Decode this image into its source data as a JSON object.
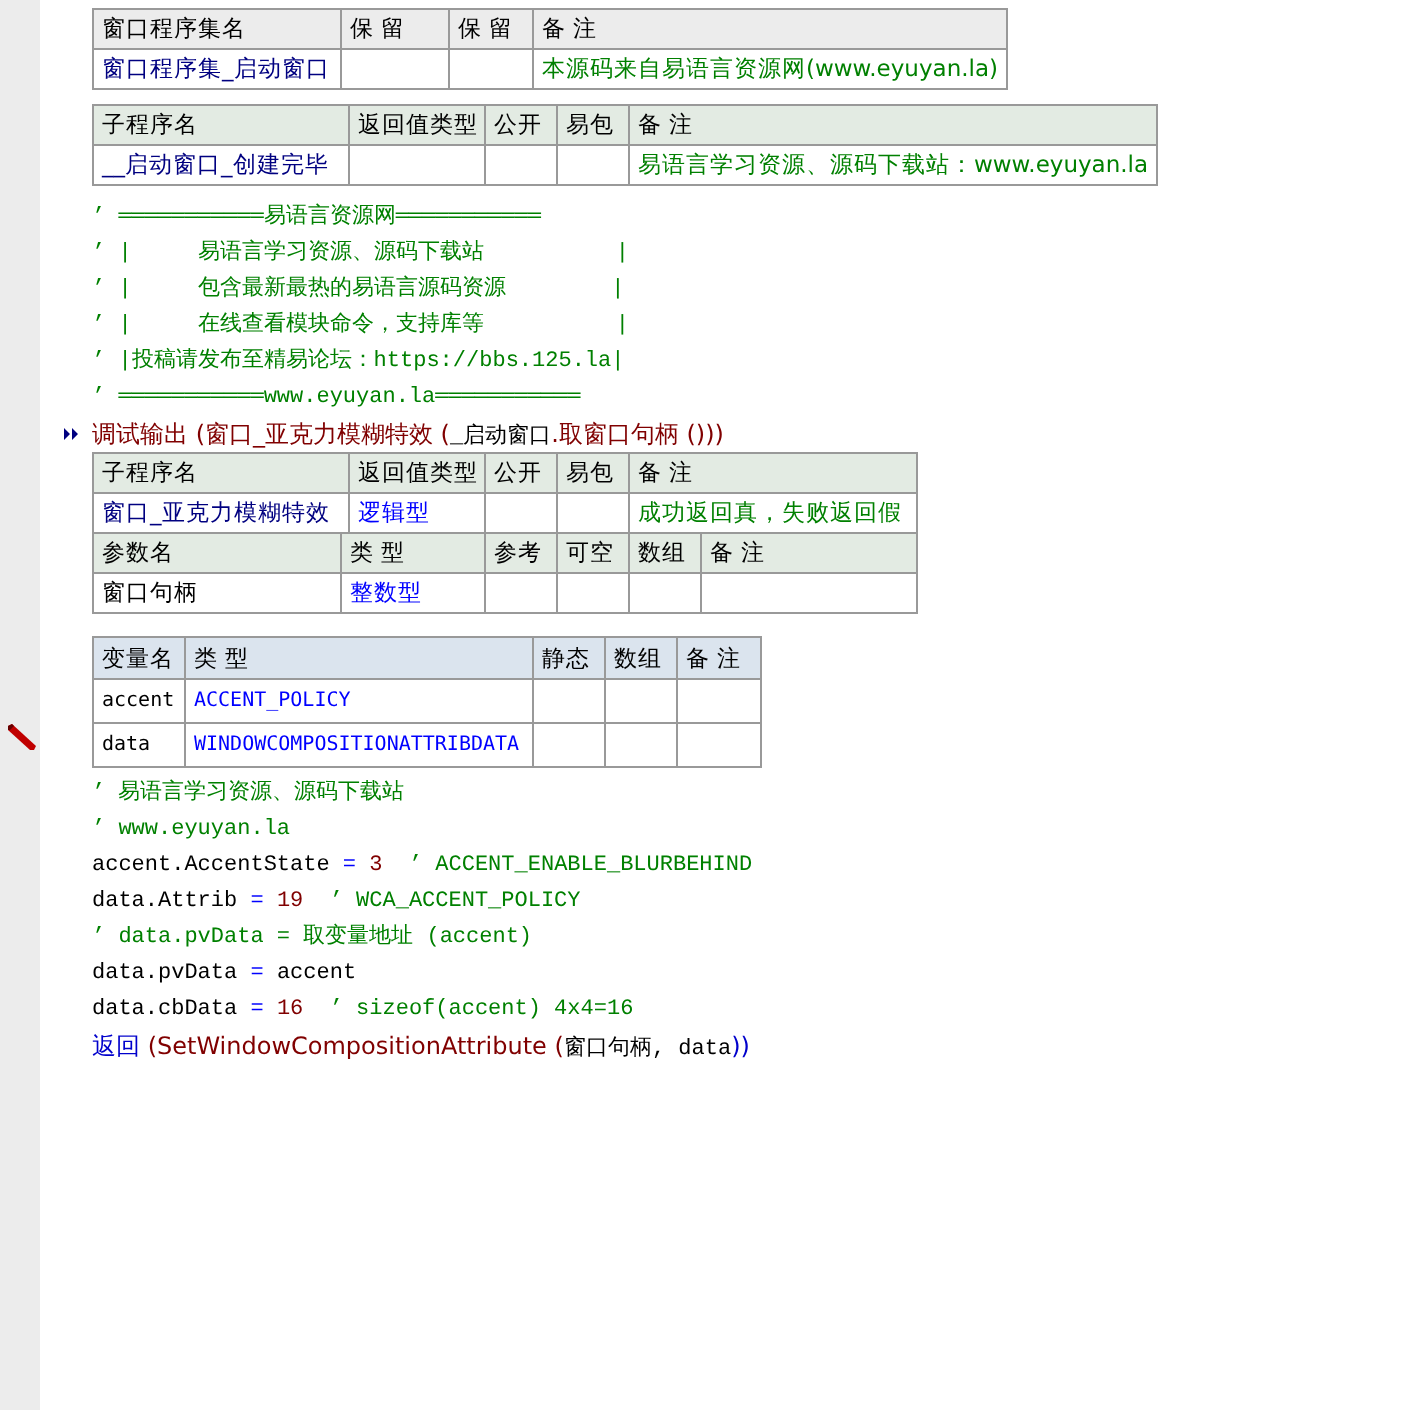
{
  "blocks": [
    {
      "kind": "assembly_table",
      "sections": [
        {
          "header": [
            "窗口程序集名",
            "保 留",
            "保 留",
            "备 注"
          ],
          "rows": [
            [
              {
                "text": "窗口程序集_启动窗口",
                "kind": "name"
              },
              {
                "text": "",
                "kind": "plain"
              },
              {
                "text": "",
                "kind": "plain"
              },
              {
                "text": "本源码来自易语言资源网(www.eyuyan.la)",
                "kind": "comment"
              }
            ]
          ]
        }
      ]
    },
    {
      "kind": "subroutine_table",
      "sections": [
        {
          "header": [
            "子程序名",
            "返回值类型",
            "公开",
            "易包",
            "备 注"
          ],
          "rows": [
            [
              {
                "text": "__启动窗口_创建完毕",
                "kind": "name"
              },
              {
                "text": "",
                "kind": "plain"
              },
              {
                "text": "",
                "kind": "plain"
              },
              {
                "text": "",
                "kind": "plain"
              },
              {
                "text": "易语言学习资源、源码下载站：www.eyuyan.la",
                "kind": "comment"
              }
            ]
          ]
        }
      ]
    },
    {
      "kind": "code",
      "current": false,
      "segments": [
        {
          "text": "’ ═══════════易语言资源网═══════════",
          "kind": "comment"
        }
      ]
    },
    {
      "kind": "code",
      "current": false,
      "segments": [
        {
          "text": "’ |     易语言学习资源、源码下载站          |",
          "kind": "comment"
        }
      ]
    },
    {
      "kind": "code",
      "current": false,
      "segments": [
        {
          "text": "’ |     包含最新最热的易语言源码资源        |",
          "kind": "comment"
        }
      ]
    },
    {
      "kind": "code",
      "current": false,
      "segments": [
        {
          "text": "’ |     在线查看模块命令，支持库等          |",
          "kind": "comment"
        }
      ]
    },
    {
      "kind": "code",
      "current": false,
      "segments": [
        {
          "text": "’ |投稿请发布至精易论坛：https://bbs.125.la|",
          "kind": "comment"
        }
      ]
    },
    {
      "kind": "code",
      "current": false,
      "segments": [
        {
          "text": "’ ═══════════www.eyuyan.la═══════════",
          "kind": "comment"
        }
      ]
    },
    {
      "kind": "code",
      "current": true,
      "segments": [
        {
          "text": "调试输出 (窗口_亚克力模糊特效 (",
          "kind": "command"
        },
        {
          "text": "_启动窗口",
          "kind": "plain"
        },
        {
          "text": ".取窗口句柄 ()))",
          "kind": "command"
        }
      ]
    },
    {
      "kind": "subroutine_table",
      "sections": [
        {
          "header": [
            "子程序名",
            "返回值类型",
            "公开",
            "易包",
            "备 注"
          ],
          "rows": [
            [
              {
                "text": "窗口_亚克力模糊特效",
                "kind": "name"
              },
              {
                "text": "逻辑型",
                "kind": "type"
              },
              {
                "text": "",
                "kind": "plain"
              },
              {
                "text": "",
                "kind": "plain"
              },
              {
                "text": "成功返回真，失败返回假",
                "kind": "comment"
              }
            ]
          ]
        },
        {
          "header": [
            "参数名",
            "类 型",
            "参考",
            "可空",
            "数组",
            "备 注"
          ],
          "rows": [
            [
              {
                "text": "窗口句柄",
                "kind": "plain"
              },
              {
                "text": "整数型",
                "kind": "type"
              },
              {
                "text": "",
                "kind": "plain"
              },
              {
                "text": "",
                "kind": "plain"
              },
              {
                "text": "",
                "kind": "plain"
              },
              {
                "text": "",
                "kind": "plain"
              }
            ]
          ]
        }
      ]
    },
    {
      "kind": "variable_table",
      "sections": [
        {
          "header": [
            "变量名",
            "类 型",
            "静态",
            "数组",
            "备 注"
          ],
          "rows": [
            [
              {
                "text": "accent",
                "kind": "plain"
              },
              {
                "text": "ACCENT_POLICY",
                "kind": "type"
              },
              {
                "text": "",
                "kind": "plain"
              },
              {
                "text": "",
                "kind": "plain"
              },
              {
                "text": "",
                "kind": "plain"
              }
            ],
            [
              {
                "text": "data",
                "kind": "plain"
              },
              {
                "text": "WINDOWCOMPOSITIONATTRIBDATA",
                "kind": "type"
              },
              {
                "text": "",
                "kind": "plain"
              },
              {
                "text": "",
                "kind": "plain"
              },
              {
                "text": "",
                "kind": "plain"
              }
            ]
          ]
        }
      ]
    },
    {
      "kind": "code",
      "current": false,
      "segments": [
        {
          "text": "’ 易语言学习资源、源码下载站",
          "kind": "comment"
        }
      ]
    },
    {
      "kind": "code",
      "current": false,
      "segments": [
        {
          "text": "’ www.eyuyan.la",
          "kind": "comment"
        }
      ]
    },
    {
      "kind": "code",
      "current": false,
      "segments": [
        {
          "text": "accent.AccentState",
          "kind": "plain"
        },
        {
          "text": " = ",
          "kind": "operator"
        },
        {
          "text": "3",
          "kind": "number"
        },
        {
          "text": "  ’ ACCENT_ENABLE_BLURBEHIND",
          "kind": "comment"
        }
      ]
    },
    {
      "kind": "code",
      "current": false,
      "segments": [
        {
          "text": "data.Attrib",
          "kind": "plain"
        },
        {
          "text": " = ",
          "kind": "operator"
        },
        {
          "text": "19",
          "kind": "number"
        },
        {
          "text": "  ’ WCA_ACCENT_POLICY",
          "kind": "comment"
        }
      ]
    },
    {
      "kind": "code",
      "current": false,
      "segments": [
        {
          "text": "’ data.pvData = 取变量地址 (accent)",
          "kind": "comment"
        }
      ]
    },
    {
      "kind": "code",
      "current": false,
      "segments": [
        {
          "text": "data.pvData",
          "kind": "plain"
        },
        {
          "text": " = ",
          "kind": "operator"
        },
        {
          "text": "accent",
          "kind": "plain"
        }
      ]
    },
    {
      "kind": "code",
      "current": false,
      "segments": [
        {
          "text": "data.cbData",
          "kind": "plain"
        },
        {
          "text": " = ",
          "kind": "operator"
        },
        {
          "text": "16",
          "kind": "number"
        },
        {
          "text": "  ’ sizeof(accent) 4x4=16",
          "kind": "comment"
        }
      ]
    },
    {
      "kind": "code",
      "current": false,
      "segments": [
        {
          "text": "返回",
          "kind": "keyword"
        },
        {
          "text": " (SetWindowCompositionAttribute (",
          "kind": "command"
        },
        {
          "text": "窗口句柄, data",
          "kind": "plain"
        },
        {
          "text": "))",
          "kind": "keyword"
        }
      ]
    }
  ]
}
